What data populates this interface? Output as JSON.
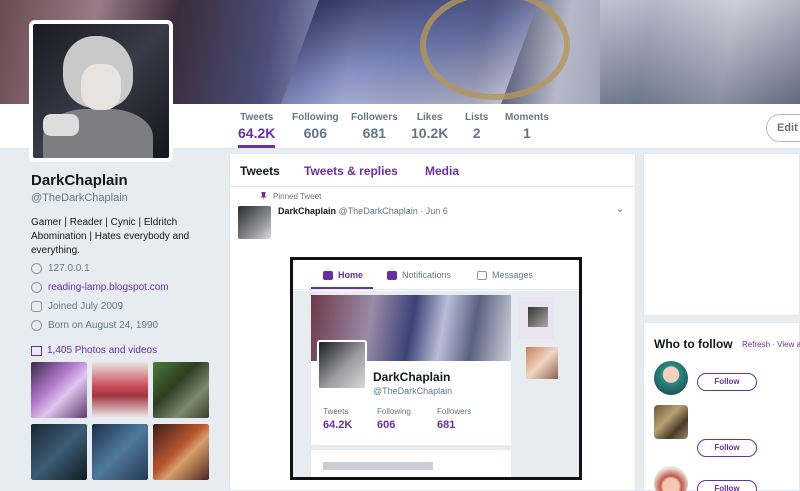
{
  "profile": {
    "name": "DarkChaplain",
    "handle": "@TheDarkChaplain",
    "bio": "Gamer | Reader | Cynic | Eldritch Abomination | Hates everybody and everything.",
    "location": "127.0.0.1",
    "website": "reading-lamp.blogspot.com",
    "joined": "Joined July 2009",
    "born": "Born on August 24, 1990",
    "photos_label": "1,405 Photos and videos"
  },
  "stats": [
    {
      "label": "Tweets",
      "value": "64.2K",
      "active": true
    },
    {
      "label": "Following",
      "value": "606"
    },
    {
      "label": "Followers",
      "value": "681"
    },
    {
      "label": "Likes",
      "value": "10.2K"
    },
    {
      "label": "Lists",
      "value": "2"
    },
    {
      "label": "Moments",
      "value": "1"
    }
  ],
  "edit_label": "Edit",
  "tabs": [
    "Tweets",
    "Tweets & replies",
    "Media"
  ],
  "pinned": {
    "label": "Pinned Tweet",
    "name": "DarkChaplain",
    "handle": "@TheDarkChaplain",
    "sep": "·",
    "date": "Jun 6"
  },
  "embed": {
    "nav": [
      "Home",
      "Notifications",
      "Messages"
    ],
    "name": "DarkChaplain",
    "handle": "@TheDarkChaplain",
    "stats": [
      {
        "label": "Tweets",
        "value": "64.2K"
      },
      {
        "label": "Following",
        "value": "606"
      },
      {
        "label": "Followers",
        "value": "681"
      }
    ]
  },
  "who_to_follow": {
    "title": "Who to follow",
    "refresh": "Refresh",
    "sep": "·",
    "view_all": "View a",
    "follow_label": "Follow"
  },
  "icons": {
    "location": "location-pin-icon",
    "website": "link-icon",
    "joined": "calendar-icon",
    "born": "balloon-icon",
    "photos": "image-icon",
    "pinned": "pin-icon",
    "home": "home-icon",
    "notifications": "bell-icon",
    "messages": "envelope-icon"
  },
  "colors": {
    "accent": "#6b2fa0",
    "background": "#e6ecf0",
    "text_secondary": "#657786"
  }
}
